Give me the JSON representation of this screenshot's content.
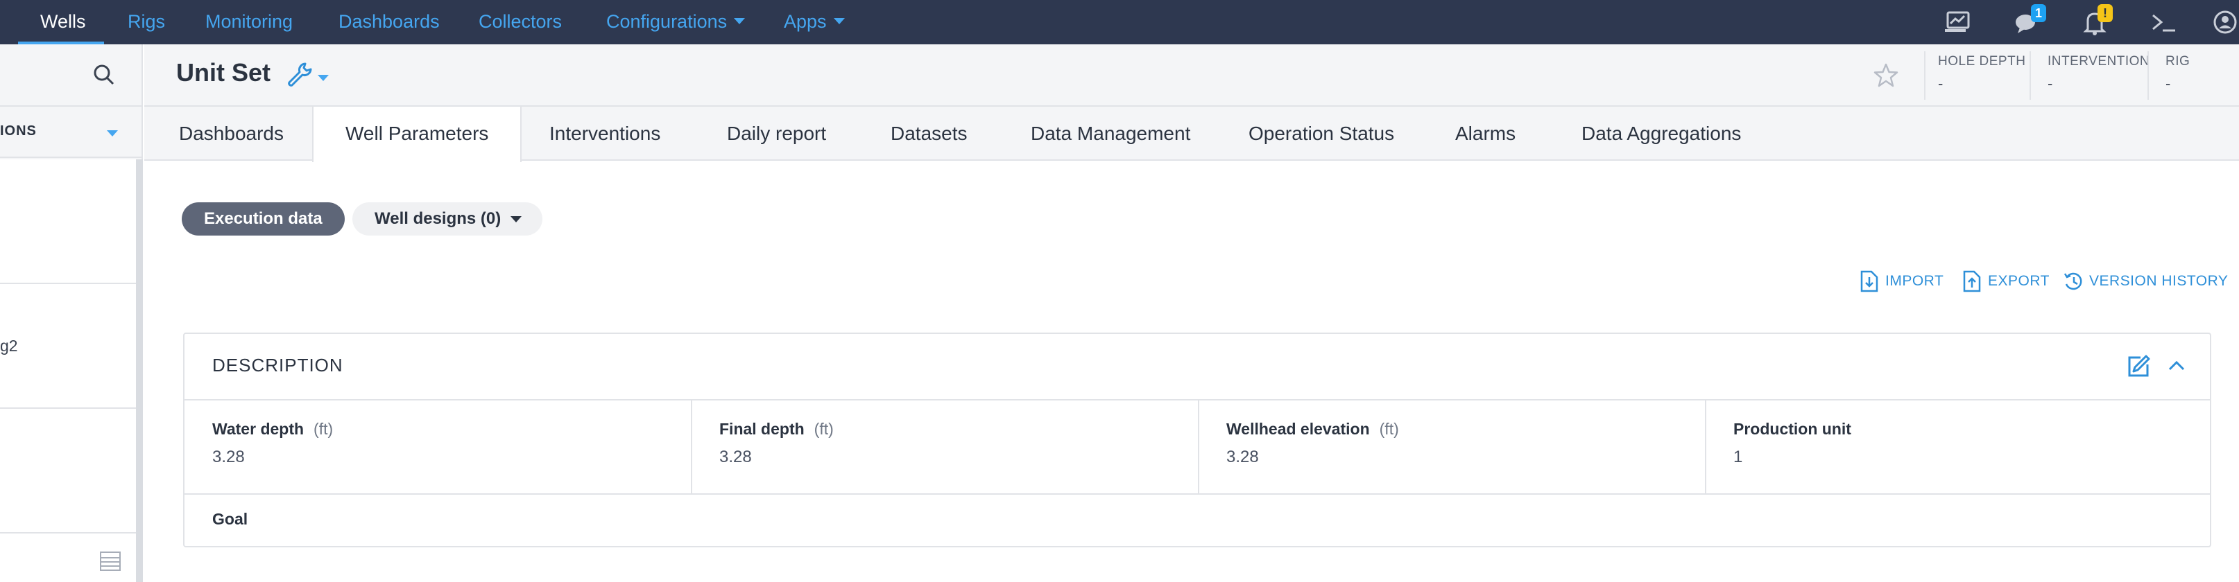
{
  "topnav": {
    "items": [
      {
        "label": "Wells",
        "active": true
      },
      {
        "label": "Rigs"
      },
      {
        "label": "Monitoring"
      },
      {
        "label": "Dashboards"
      },
      {
        "label": "Collectors"
      },
      {
        "label": "Configurations",
        "dropdown": true
      },
      {
        "label": "Apps",
        "dropdown": true
      }
    ],
    "icons": {
      "monitor": "monitor-chart-icon",
      "chat": "chat-icon",
      "chat_badge": "1",
      "bell": "bell-icon",
      "bell_badge": "!",
      "terminal": "terminal-icon",
      "user": "user-icon"
    }
  },
  "sidebar": {
    "search_icon": "search-icon",
    "filter_label": "IONS",
    "items": [
      {
        "label": ""
      },
      {
        "label": "g2"
      },
      {
        "label": ""
      }
    ],
    "table_icon": "table-icon"
  },
  "header": {
    "title": "Unit Set",
    "stats": [
      {
        "label": "HOLE DEPTH",
        "value": "-"
      },
      {
        "label": "INTERVENTION",
        "value": "-"
      },
      {
        "label": "RIG",
        "value": "-"
      }
    ]
  },
  "tabs": [
    {
      "label": "Dashboards"
    },
    {
      "label": "Well Parameters",
      "active": true
    },
    {
      "label": "Interventions"
    },
    {
      "label": "Daily report"
    },
    {
      "label": "Datasets"
    },
    {
      "label": "Data Management"
    },
    {
      "label": "Operation Status"
    },
    {
      "label": "Alarms"
    },
    {
      "label": "Data Aggregations"
    }
  ],
  "content": {
    "pills": {
      "execution": "Execution data",
      "designs": "Well designs (0)"
    },
    "actions": {
      "import": "IMPORT",
      "export": "EXPORT",
      "history": "VERSION HISTORY"
    },
    "panel": {
      "title": "DESCRIPTION",
      "fields": [
        {
          "label": "Water depth",
          "unit": "(ft)",
          "value": "3.28"
        },
        {
          "label": "Final depth",
          "unit": "(ft)",
          "value": "3.28"
        },
        {
          "label": "Wellhead elevation",
          "unit": "(ft)",
          "value": "3.28"
        },
        {
          "label": "Production unit",
          "unit": "",
          "value": "1"
        }
      ],
      "goal_label": "Goal"
    }
  },
  "colors": {
    "nav_bg": "#2e3850",
    "accent": "#45a6f0",
    "pill_dark": "#5e6678"
  }
}
